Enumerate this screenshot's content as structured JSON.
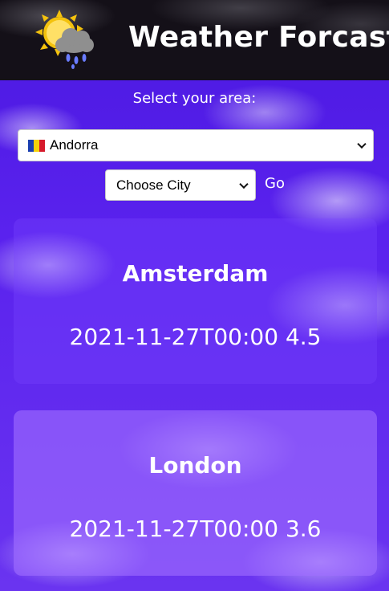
{
  "header": {
    "title": "Weather Forcast",
    "logo_icon": "sun-cloud-rain-icon"
  },
  "area_label": "Select your area:",
  "country_select": {
    "selected": "Andorra",
    "flag_icon": "andorra-flag-icon"
  },
  "city_select": {
    "selected": "Choose City"
  },
  "go_label": "Go",
  "cards": [
    {
      "city": "Amsterdam",
      "time": "2021-11-27T00:00",
      "value": "4.5"
    },
    {
      "city": "London",
      "time": "2021-11-27T00:00",
      "value": "3.6"
    }
  ]
}
